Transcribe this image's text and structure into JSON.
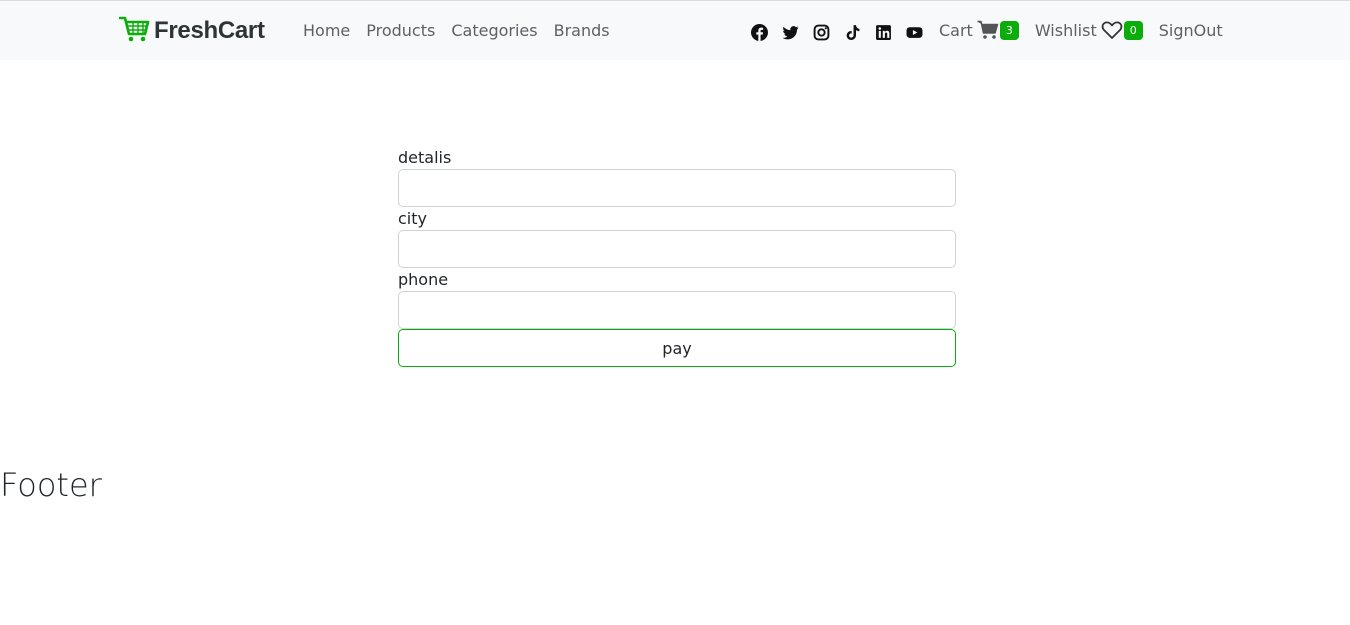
{
  "brand": {
    "name": "FreshCart",
    "color": "#0aad0a"
  },
  "nav": {
    "links": [
      "Home",
      "Products",
      "Categories",
      "Brands"
    ],
    "socials": [
      "facebook-icon",
      "twitter-icon",
      "instagram-icon",
      "tiktok-icon",
      "linkedin-icon",
      "youtube-icon"
    ],
    "cart_label": "Cart",
    "cart_count": "3",
    "wishlist_label": "Wishlist",
    "wishlist_count": "0",
    "signout_label": "SignOut"
  },
  "form": {
    "details_label": "detalis",
    "details_value": "",
    "city_label": "city",
    "city_value": "",
    "phone_label": "phone",
    "phone_value": "",
    "pay_label": "pay"
  },
  "footer": {
    "text": "Footer"
  }
}
